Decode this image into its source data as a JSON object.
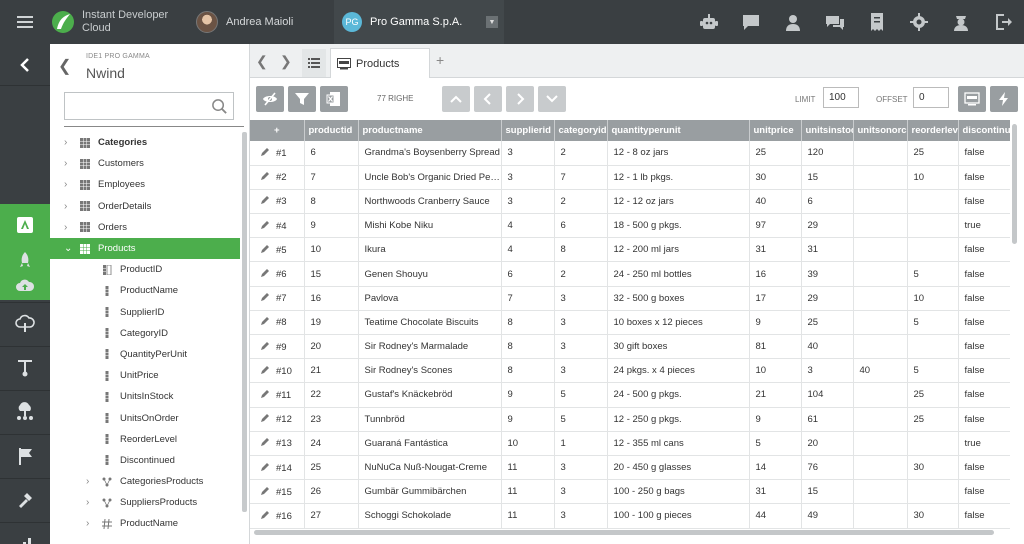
{
  "app": {
    "brand_line1": "Instant Developer",
    "brand_line2": "Cloud",
    "user": "Andrea Maioli",
    "company_badge": "PG",
    "company_name": "Pro Gamma S.p.A."
  },
  "top_icons": [
    "robot-icon",
    "chat-icon",
    "support-icon",
    "messages-icon",
    "receipt-icon",
    "gear-icon",
    "admin-icon",
    "logout-icon"
  ],
  "rail_icons": [
    "app-icon",
    "rocket-icon",
    "cloud-upload-icon",
    "cloud-sync-icon",
    "deploy-icon",
    "network-icon",
    "flag-icon",
    "satellite-icon",
    "chart-icon"
  ],
  "tree": {
    "subtitle": "IDE1 PRO GAMMA",
    "title": "Nwind",
    "search_placeholder": "",
    "nodes": [
      {
        "label": "Categories",
        "level": 0,
        "bold": true,
        "exp": "›",
        "icon": "table"
      },
      {
        "label": "Customers",
        "level": 0,
        "exp": "›",
        "icon": "table"
      },
      {
        "label": "Employees",
        "level": 0,
        "exp": "›",
        "icon": "table"
      },
      {
        "label": "OrderDetails",
        "level": 0,
        "exp": "›",
        "icon": "table"
      },
      {
        "label": "Orders",
        "level": 0,
        "exp": "›",
        "icon": "table"
      },
      {
        "label": "Products",
        "level": 0,
        "exp": "⌄",
        "icon": "table",
        "selected": true
      },
      {
        "label": "ProductID",
        "level": 1,
        "icon": "key"
      },
      {
        "label": "ProductName",
        "level": 1,
        "icon": "field"
      },
      {
        "label": "SupplierID",
        "level": 1,
        "icon": "field"
      },
      {
        "label": "CategoryID",
        "level": 1,
        "icon": "field"
      },
      {
        "label": "QuantityPerUnit",
        "level": 1,
        "icon": "field"
      },
      {
        "label": "UnitPrice",
        "level": 1,
        "icon": "field"
      },
      {
        "label": "UnitsInStock",
        "level": 1,
        "icon": "field"
      },
      {
        "label": "UnitsOnOrder",
        "level": 1,
        "icon": "field"
      },
      {
        "label": "ReorderLevel",
        "level": 1,
        "icon": "field"
      },
      {
        "label": "Discontinued",
        "level": 1,
        "icon": "field"
      },
      {
        "label": "CategoriesProducts",
        "level": 1,
        "exp": "›",
        "icon": "relation"
      },
      {
        "label": "SuppliersProducts",
        "level": 1,
        "exp": "›",
        "icon": "relation"
      },
      {
        "label": "ProductName",
        "level": 1,
        "exp": "›",
        "icon": "index"
      }
    ]
  },
  "tab": {
    "label": "Products"
  },
  "toolbar": {
    "rows": "77 RIGHE",
    "limit_label": "LIMIT",
    "limit_value": "100",
    "offset_label": "OFFSET",
    "offset_value": "0"
  },
  "grid": {
    "add": "+",
    "columns": [
      "productid",
      "productname",
      "supplierid",
      "categoryid",
      "quantityperunit",
      "unitprice",
      "unitsinstoc",
      "unitsonorc",
      "reorderlev",
      "discontinu"
    ],
    "rows": [
      [
        "#1",
        "6",
        "Grandma's Boysenberry Spread",
        "3",
        "2",
        "12 - 8 oz jars",
        "25",
        "120",
        "",
        "25",
        "false"
      ],
      [
        "#2",
        "7",
        "Uncle Bob's Organic Dried Pears",
        "3",
        "7",
        "12 - 1 lb pkgs.",
        "30",
        "15",
        "",
        "10",
        "false"
      ],
      [
        "#3",
        "8",
        "Northwoods Cranberry Sauce",
        "3",
        "2",
        "12 - 12 oz jars",
        "40",
        "6",
        "",
        "",
        "false"
      ],
      [
        "#4",
        "9",
        "Mishi Kobe Niku",
        "4",
        "6",
        "18 - 500 g pkgs.",
        "97",
        "29",
        "",
        "",
        "true"
      ],
      [
        "#5",
        "10",
        "Ikura",
        "4",
        "8",
        "12 - 200 ml jars",
        "31",
        "31",
        "",
        "",
        "false"
      ],
      [
        "#6",
        "15",
        "Genen Shouyu",
        "6",
        "2",
        "24 - 250 ml bottles",
        "16",
        "39",
        "",
        "5",
        "false"
      ],
      [
        "#7",
        "16",
        "Pavlova",
        "7",
        "3",
        "32 - 500 g boxes",
        "17",
        "29",
        "",
        "10",
        "false"
      ],
      [
        "#8",
        "19",
        "Teatime Chocolate Biscuits",
        "8",
        "3",
        "10 boxes x 12 pieces",
        "9",
        "25",
        "",
        "5",
        "false"
      ],
      [
        "#9",
        "20",
        "Sir Rodney's Marmalade",
        "8",
        "3",
        "30 gift boxes",
        "81",
        "40",
        "",
        "",
        "false"
      ],
      [
        "#10",
        "21",
        "Sir Rodney's Scones",
        "8",
        "3",
        "24 pkgs. x 4 pieces",
        "10",
        "3",
        "40",
        "5",
        "false"
      ],
      [
        "#11",
        "22",
        "Gustaf's Knäckebröd",
        "9",
        "5",
        "24 - 500 g pkgs.",
        "21",
        "104",
        "",
        "25",
        "false"
      ],
      [
        "#12",
        "23",
        "Tunnbröd",
        "9",
        "5",
        "12 - 250 g pkgs.",
        "9",
        "61",
        "",
        "25",
        "false"
      ],
      [
        "#13",
        "24",
        "Guaraná Fantástica",
        "10",
        "1",
        "12 - 355 ml cans",
        "5",
        "20",
        "",
        "",
        "true"
      ],
      [
        "#14",
        "25",
        "NuNuCa Nuß-Nougat-Creme",
        "11",
        "3",
        "20 - 450 g glasses",
        "14",
        "76",
        "",
        "30",
        "false"
      ],
      [
        "#15",
        "26",
        "Gumbär Gummibärchen",
        "11",
        "3",
        "100 - 250 g bags",
        "31",
        "15",
        "",
        "",
        "false"
      ],
      [
        "#16",
        "27",
        "Schoggi Schokolade",
        "11",
        "3",
        "100 - 100 g pieces",
        "44",
        "49",
        "",
        "30",
        "false"
      ]
    ]
  }
}
